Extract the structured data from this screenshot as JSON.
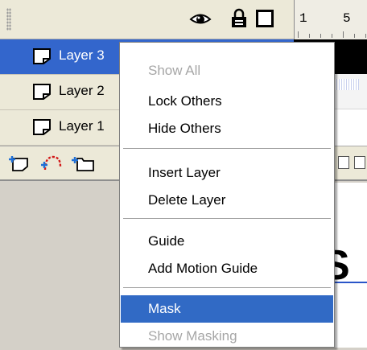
{
  "timeline": {
    "ruler": {
      "labels": [
        "1",
        "5"
      ]
    },
    "header_icons": [
      "eye-icon",
      "lock-icon",
      "outline-icon"
    ],
    "layers": [
      {
        "name": "Layer 3",
        "selected": true
      },
      {
        "name": "Layer 2",
        "selected": false
      },
      {
        "name": "Layer 1",
        "selected": false
      }
    ],
    "toolbar_icons": [
      "insert-layer-icon",
      "add-motion-guide-icon",
      "insert-layer-folder-icon"
    ]
  },
  "context_menu": {
    "items": [
      {
        "label": "Show All",
        "state": "disabled"
      },
      {
        "label": "Lock Others",
        "state": "normal"
      },
      {
        "label": "Hide Others",
        "state": "normal"
      },
      {
        "label": "Insert Layer",
        "state": "normal"
      },
      {
        "label": "Delete Layer",
        "state": "normal"
      },
      {
        "label": "Guide",
        "state": "normal"
      },
      {
        "label": "Add Motion Guide",
        "state": "normal"
      },
      {
        "label": "Mask",
        "state": "highlighted"
      },
      {
        "label": "Show Masking",
        "state": "disabled"
      }
    ]
  },
  "stage": {
    "visible_text": "S"
  },
  "colors": {
    "selection": "#3366cc",
    "menu_highlight": "#316ac5",
    "disabled_text": "#a6a6a6",
    "panel": "#ece9d8",
    "keyframe_yellow": "#ffff00"
  }
}
